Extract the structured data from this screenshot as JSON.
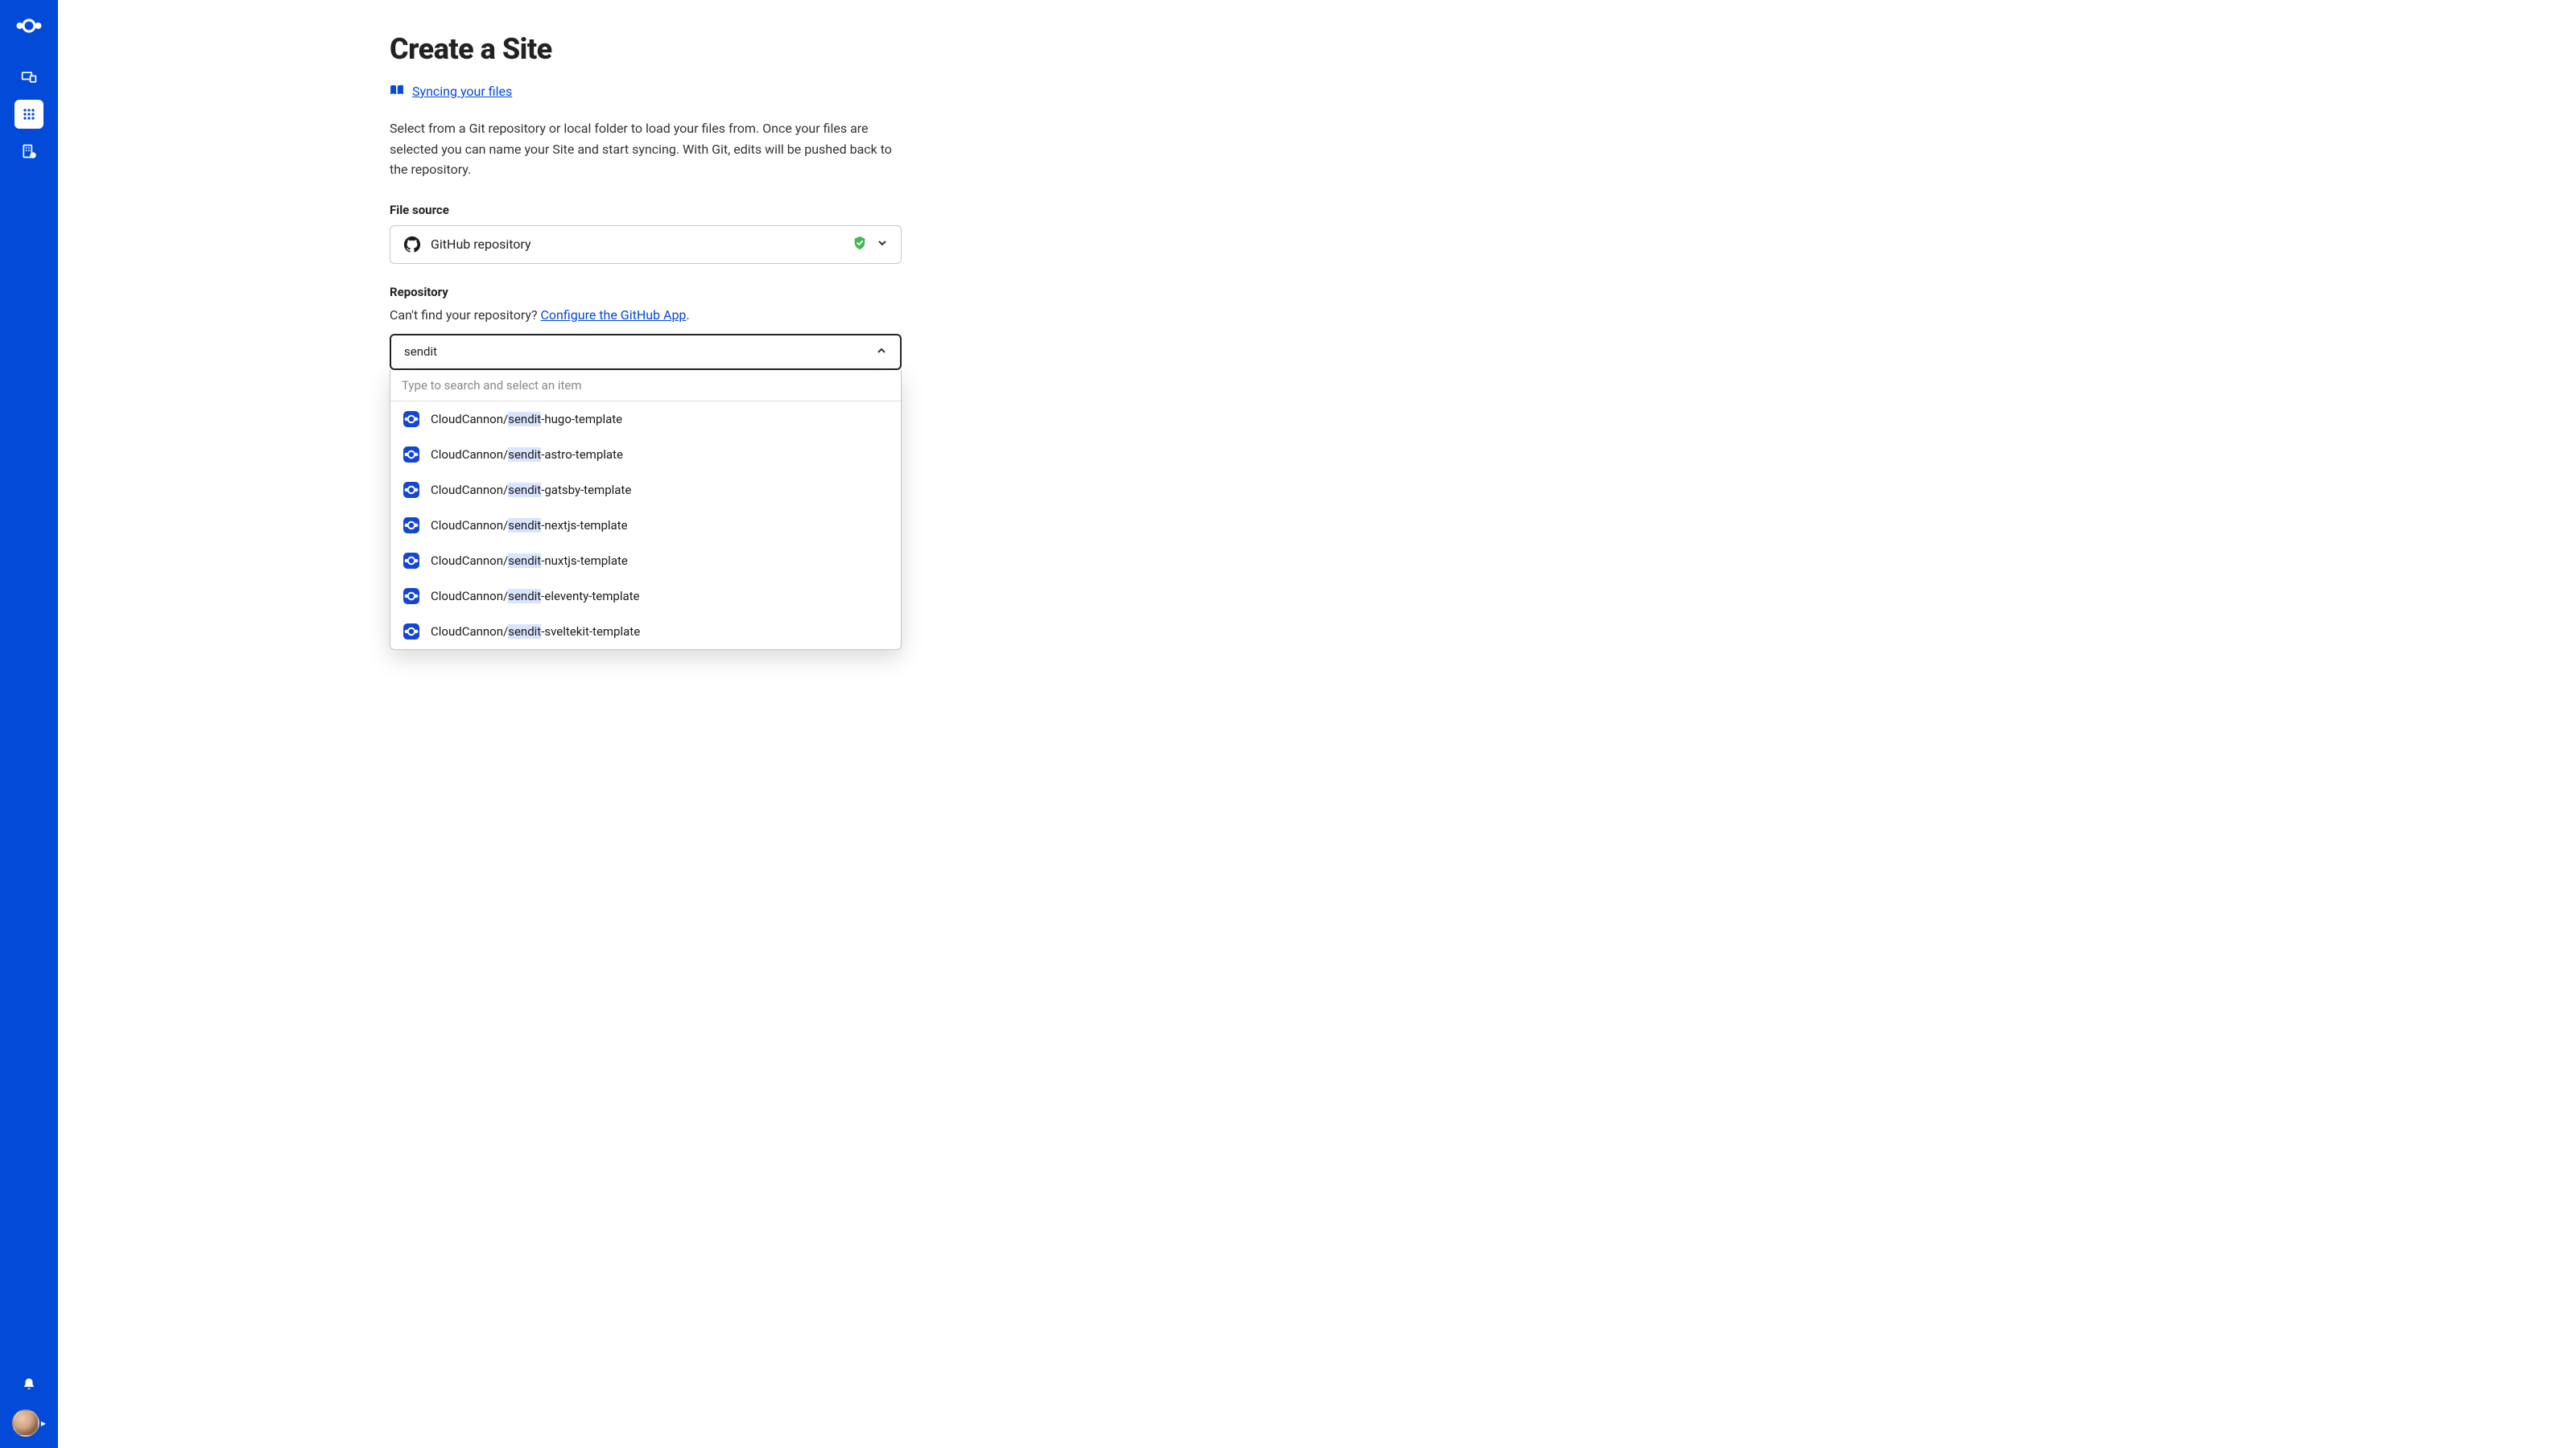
{
  "sidebar": {},
  "header": {
    "title": "Create a Site",
    "help_link_text": "Syncing your files",
    "description": "Select from a Git repository or local folder to load your files from. Once your files are selected you can name your Site and start syncing. With Git, edits will be pushed back to the repository."
  },
  "file_source": {
    "label": "File source",
    "selected": "GitHub repository"
  },
  "repository": {
    "label": "Repository",
    "help_prefix": "Can't find your repository? ",
    "configure_link": "Configure the GitHub App",
    "help_suffix": ".",
    "search_value": "sendit",
    "dropdown_hint": "Type to search and select an item",
    "search_highlight": "sendit",
    "options": [
      {
        "prefix": "CloudCannon/",
        "match": "sendit",
        "suffix": "-hugo-template"
      },
      {
        "prefix": "CloudCannon/",
        "match": "sendit",
        "suffix": "-astro-template"
      },
      {
        "prefix": "CloudCannon/",
        "match": "sendit",
        "suffix": "-gatsby-template"
      },
      {
        "prefix": "CloudCannon/",
        "match": "sendit",
        "suffix": "-nextjs-template"
      },
      {
        "prefix": "CloudCannon/",
        "match": "sendit",
        "suffix": "-nuxtjs-template"
      },
      {
        "prefix": "CloudCannon/",
        "match": "sendit",
        "suffix": "-eleventy-template"
      },
      {
        "prefix": "CloudCannon/",
        "match": "sendit",
        "suffix": "-sveltekit-template"
      }
    ]
  }
}
